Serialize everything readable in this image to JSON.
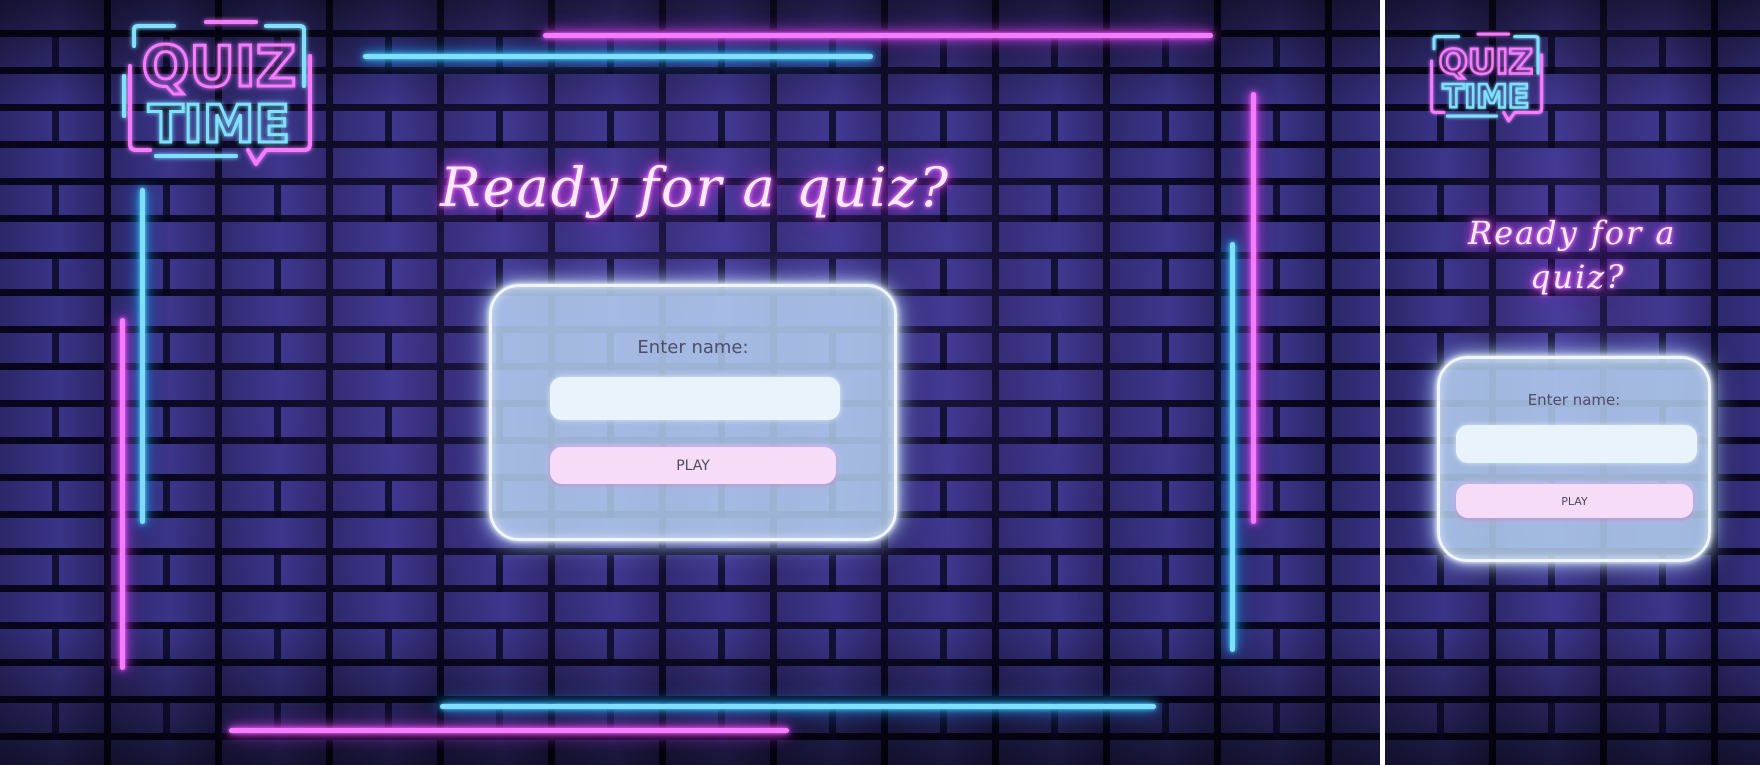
{
  "logo": {
    "line1": "QUIZ",
    "line2": "TIME"
  },
  "headline": "Ready for a quiz?",
  "headline_narrow": {
    "line1": "Ready for a",
    "line2": "quiz?"
  },
  "form": {
    "name_label": "Enter name:",
    "name_value": "",
    "name_placeholder": "",
    "play_label": "PLAY"
  },
  "colors": {
    "neon_pink": "#f57cff",
    "neon_blue": "#7fe0ff",
    "card_bg": "#b9d7f5",
    "input_bg": "#e9f3fc",
    "button_bg": "#f6dcf7"
  },
  "icons": {
    "logo": "quiz-time-neon-speech-bubble-icon"
  }
}
